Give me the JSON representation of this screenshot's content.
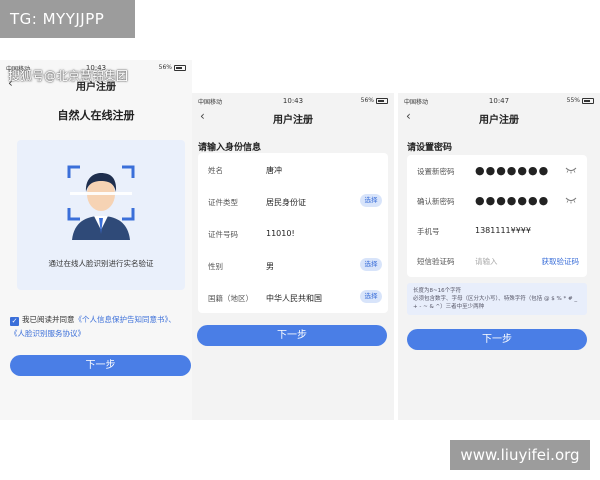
{
  "overlay": {
    "tag": "TG: MYYJJPP",
    "watermark": "搜狐号@北京慧锦集团",
    "site": "www.liuyifei.org"
  },
  "phone1": {
    "status": {
      "carrier": "中国移动",
      "time": "10:43",
      "battery": "56%"
    },
    "nav_title": "用户注册",
    "heading": "自然人在线注册",
    "face_caption": "通过在线人脸识别进行实名验证",
    "agree_prefix": "我已阅读并同意",
    "agree_link1": "《个人信息保护告知同意书》",
    "agree_sep": "、",
    "agree_link2": "《人脸识别服务协议》",
    "next_label": "下一步"
  },
  "phone2": {
    "status": {
      "carrier": "中国移动",
      "time": "10:43",
      "battery": "56%"
    },
    "nav_title": "用户注册",
    "section_title": "请输入身份信息",
    "rows": [
      {
        "label": "姓名",
        "value": "唐冲",
        "action": ""
      },
      {
        "label": "证件类型",
        "value": "居民身份证",
        "action": "选择"
      },
      {
        "label": "证件号码",
        "value": "11010!",
        "action": ""
      },
      {
        "label": "性别",
        "value": "男",
        "action": "选择"
      },
      {
        "label": "国籍（地区）",
        "value": "中华人民共和国",
        "action": "选择"
      }
    ],
    "next_label": "下一步"
  },
  "phone3": {
    "status": {
      "carrier": "中国移动",
      "time": "10:47",
      "battery": "55%"
    },
    "nav_title": "用户注册",
    "section_title": "请设置密码",
    "new_pwd_label": "设置新密码",
    "new_pwd_value": "●●●●●●●",
    "confirm_pwd_label": "确认新密码",
    "confirm_pwd_value": "●●●●●●●",
    "phone_label": "手机号",
    "phone_value": "1381111¥¥¥¥",
    "sms_label": "短信验证码",
    "sms_placeholder": "请输入",
    "sms_button": "获取验证码",
    "hint_line1": "长度为8~16个字符",
    "hint_line2": "必须包含数字、字母（区分大小写）、特殊字符（包括 @ $ % * # _ + - ~ & ^）三者中至少两种",
    "next_label": "下一步"
  },
  "colors": {
    "accent": "#4a7ee6",
    "pill_bg": "#d8e4fa",
    "card_bg": "#eaf0fb",
    "tag_bg": "#9c9c9c"
  },
  "icons": {
    "back": "chevron-left-icon",
    "eye": "eye-closed-icon",
    "face": "face-scan-icon",
    "check": "checkbox-icon"
  }
}
